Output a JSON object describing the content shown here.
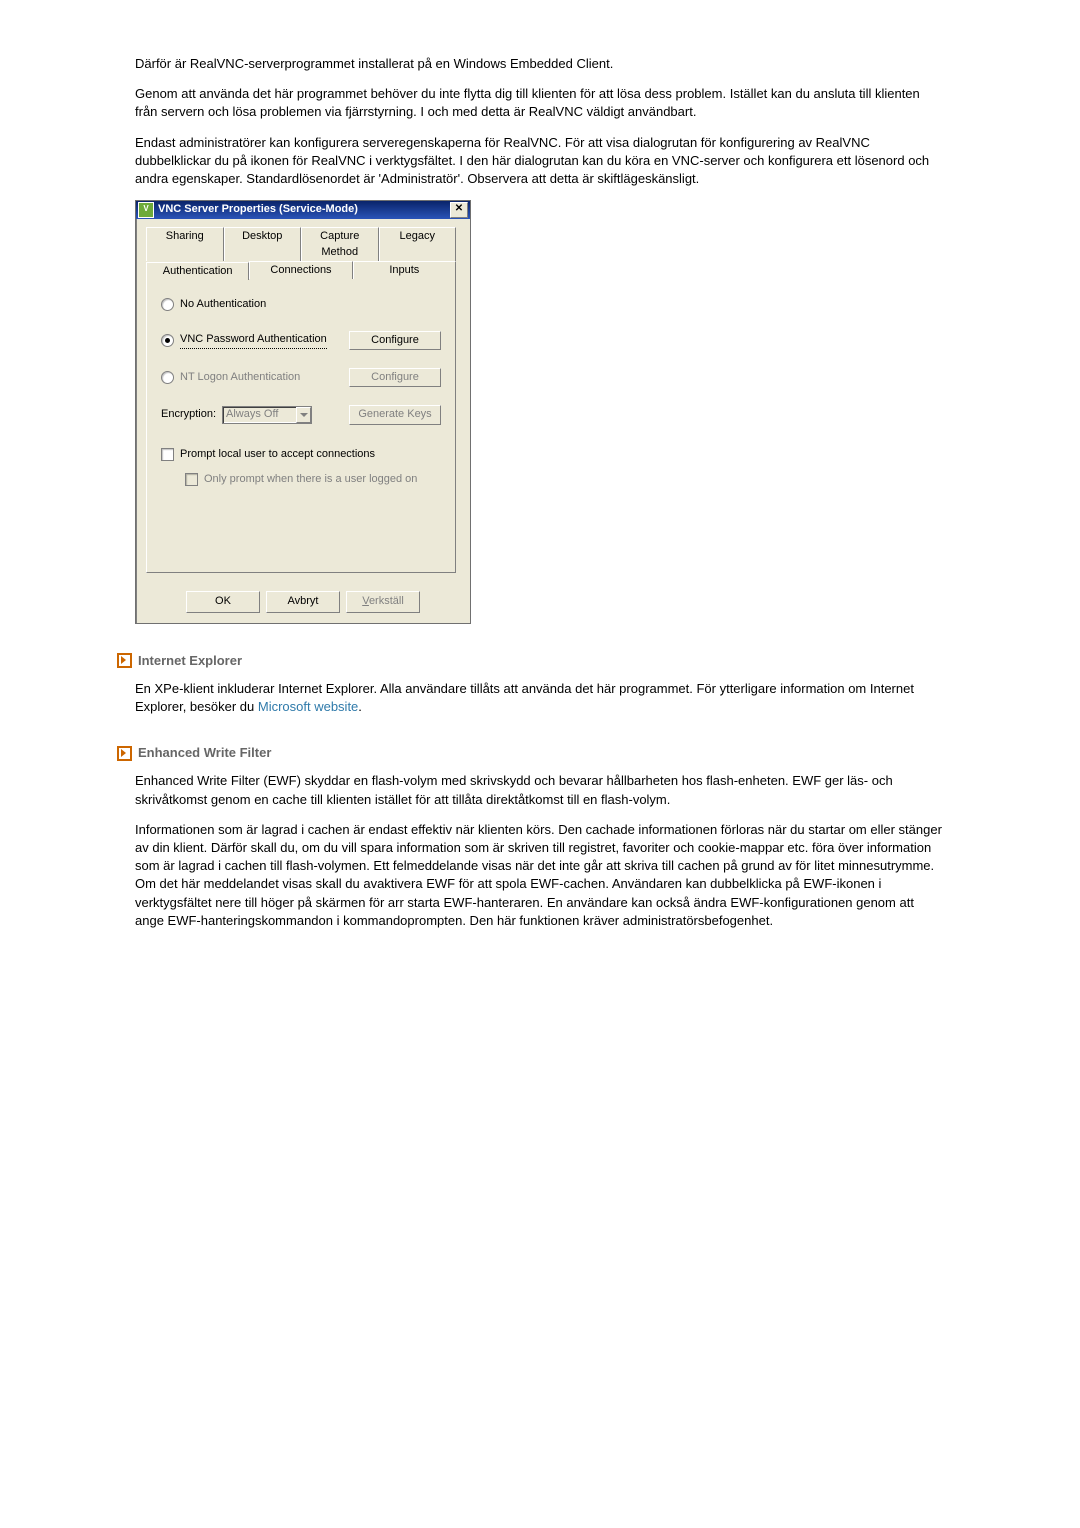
{
  "intro": {
    "p1": "Därför är RealVNC-serverprogrammet installerat på en Windows Embedded Client.",
    "p2": "Genom att använda det här programmet behöver du inte flytta dig till klienten för att lösa dess problem. Istället kan du ansluta till klienten från servern och lösa problemen via fjärrstyrning. I och med detta är RealVNC väldigt användbart.",
    "p3": "Endast administratörer kan konfigurera serveregenskaperna för RealVNC. För att visa dialogrutan för konfigurering av RealVNC dubbelklickar du på ikonen för RealVNC i verktygsfältet. I den här dialogrutan kan du köra en VNC-server och konfigurera ett lösenord och andra egenskaper. Standardlösenordet är 'Administratör'. Observera att detta är skiftlägeskänsligt."
  },
  "dialog": {
    "title": "VNC Server Properties (Service-Mode)",
    "tabs_back": [
      "Sharing",
      "Desktop",
      "Capture Method",
      "Legacy"
    ],
    "tabs_front": [
      "Authentication",
      "Connections",
      "Inputs"
    ],
    "auth": {
      "none": "No Authentication",
      "pwd": "VNC Password Authentication",
      "nt": "NT Logon Authentication",
      "configure": "Configure",
      "encryption": "Encryption:",
      "always_off": "Always Off",
      "genkeys": "Generate Keys",
      "prompt": "Prompt local user to accept connections",
      "onlyprompt": "Only prompt when there is a user logged on"
    },
    "buttons": {
      "ok": "OK",
      "cancel": "Avbryt",
      "apply_pre": "V",
      "apply_post": "erkställ"
    }
  },
  "ie": {
    "heading": "Internet Explorer",
    "body_a": "En XPe-klient inkluderar Internet Explorer. Alla användare tillåts att använda det här programmet. För ytterligare information om Internet Explorer, besöker du ",
    "link": "Microsoft website",
    "body_b": "."
  },
  "ewf": {
    "heading": "Enhanced Write Filter",
    "p1": "Enhanced Write Filter (EWF) skyddar en flash-volym med skrivskydd och bevarar hållbarheten hos flash-enheten. EWF ger läs- och skrivåtkomst genom en cache till klienten istället för att tillåta direktåtkomst till en flash-volym.",
    "p2": "Informationen som är lagrad i cachen är endast effektiv när klienten körs. Den cachade informationen förloras när du startar om eller stänger av din klient. Därför skall du, om du vill spara information som är skriven till registret, favoriter och cookie-mappar etc. föra över information som är lagrad i cachen till flash-volymen. Ett felmeddelande visas när det inte går att skriva till cachen på grund av för litet minnesutrymme. Om det här meddelandet visas skall du avaktivera EWF för att spola EWF-cachen. Användaren kan dubbelklicka på EWF-ikonen i verktygsfältet nere till höger på skärmen för arr starta EWF-hanteraren. En användare kan också ändra EWF-konfigurationen genom att ange EWF-hanteringskommandon i kommandoprompten. Den här funktionen kräver administratörsbefogenhet."
  }
}
